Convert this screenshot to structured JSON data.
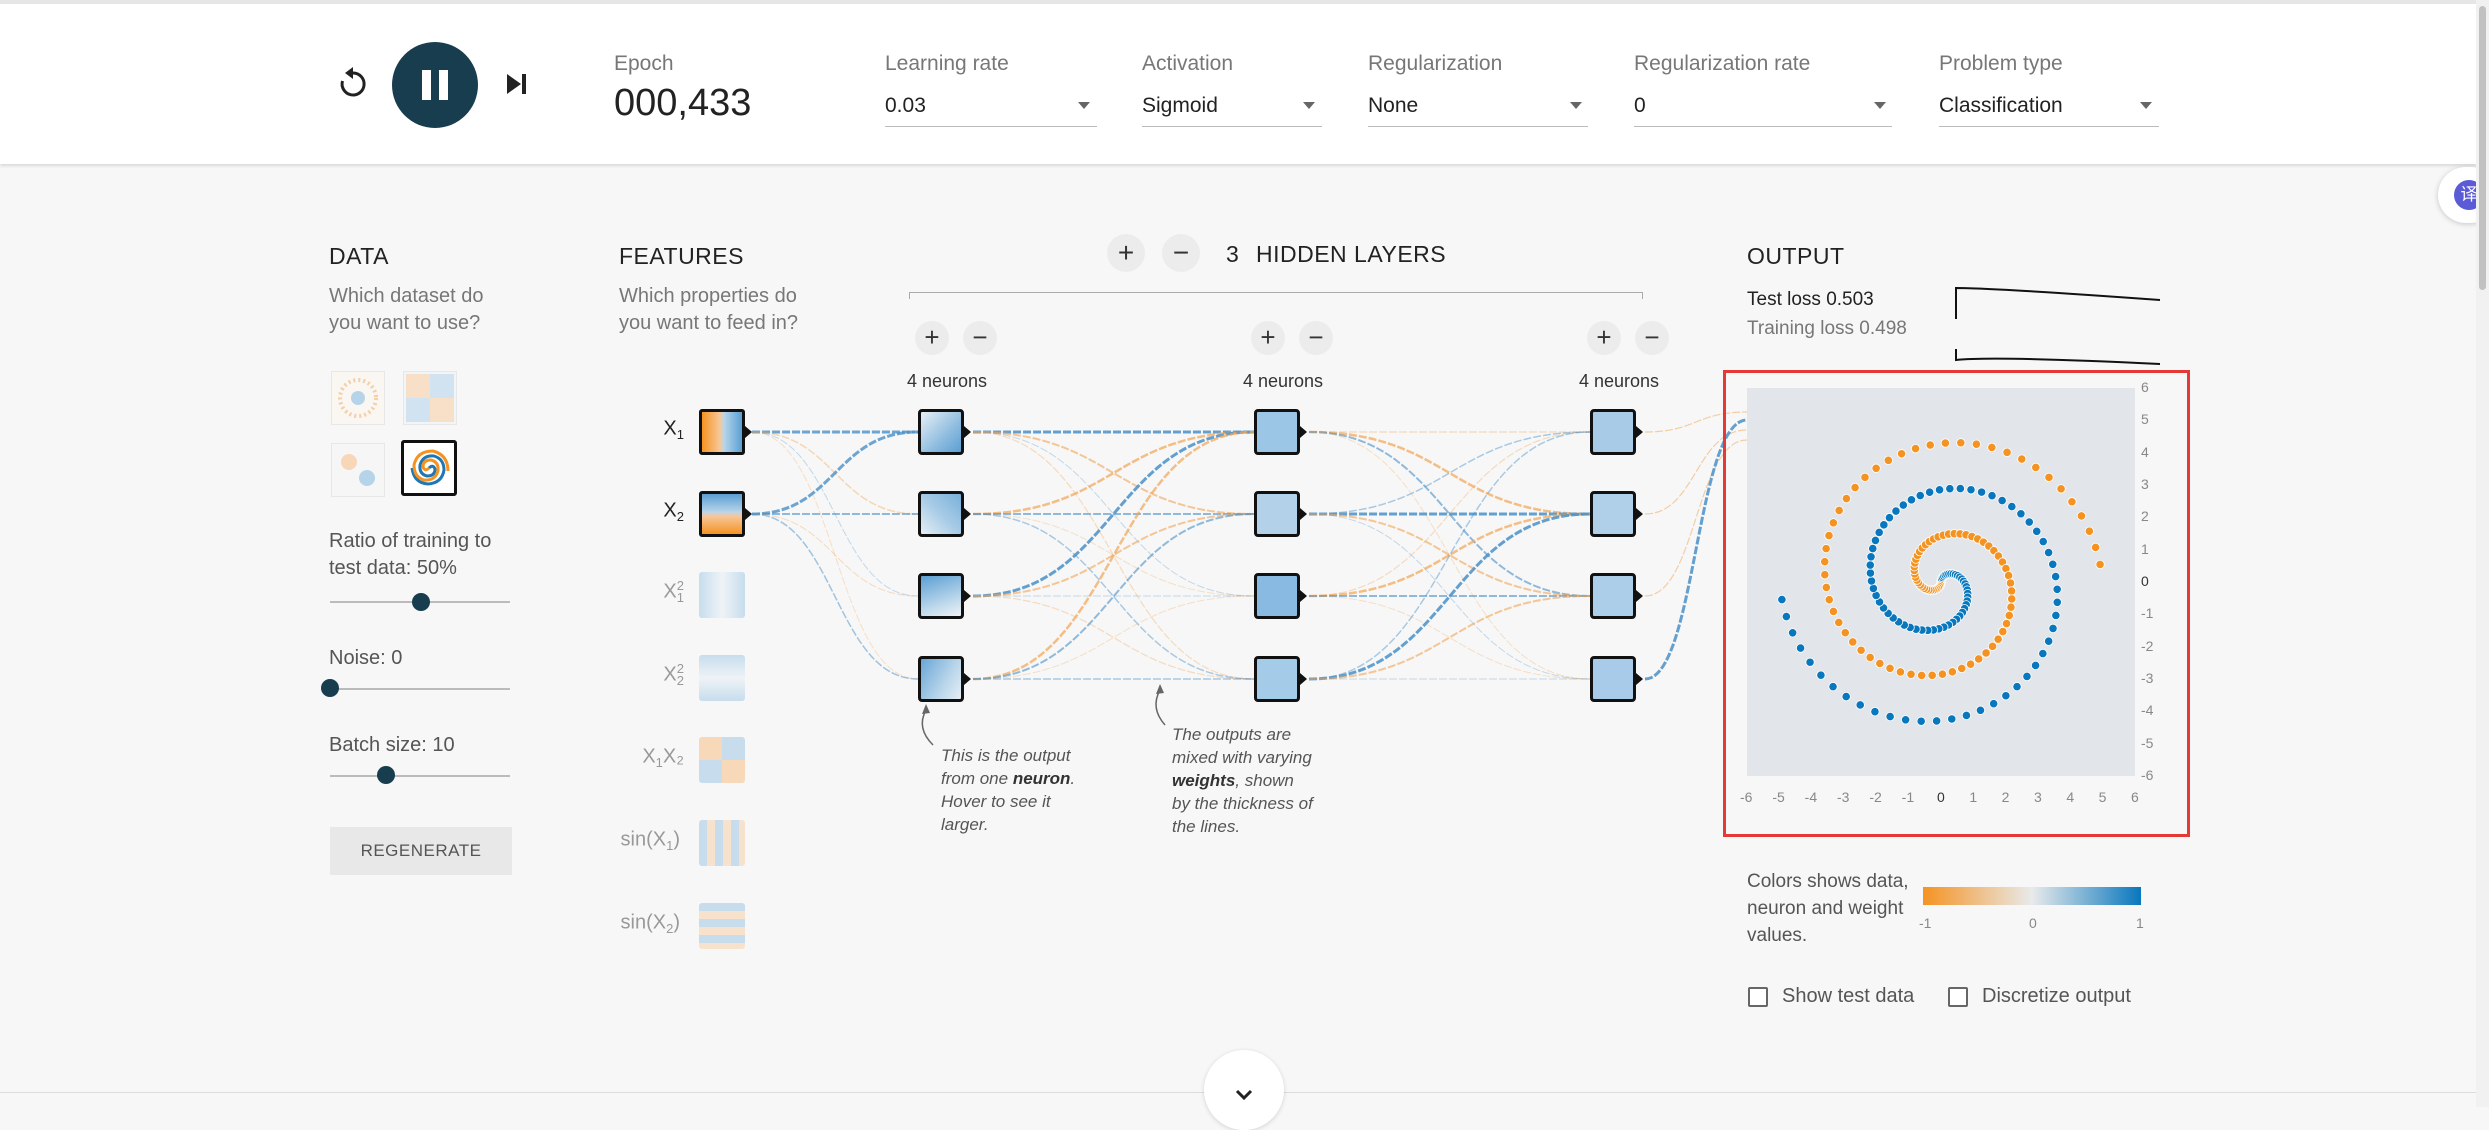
{
  "header": {
    "reset_icon": "reset-icon",
    "play_pause_icon": "pause-icon",
    "step_icon": "step-forward-icon",
    "epoch_label": "Epoch",
    "epoch_value": "000,433",
    "learning_rate_label": "Learning rate",
    "learning_rate_value": "0.03",
    "activation_label": "Activation",
    "activation_value": "Sigmoid",
    "regularization_label": "Regularization",
    "regularization_value": "None",
    "regularization_rate_label": "Regularization rate",
    "regularization_rate_value": "0",
    "problem_type_label": "Problem type",
    "problem_type_value": "Classification"
  },
  "data_panel": {
    "title": "DATA",
    "desc": "Which dataset do you want to use?",
    "ratio_label": "Ratio of training to test data:",
    "ratio_value": "50%",
    "ratio_fraction": 0.5,
    "noise_label": "Noise:",
    "noise_value": "0",
    "noise_fraction": 0,
    "batch_label": "Batch size:",
    "batch_value": "10",
    "batch_fraction": 0.3,
    "regenerate": "REGENERATE",
    "datasets": [
      "circle",
      "xor",
      "gauss",
      "spiral"
    ],
    "selected_dataset": "spiral"
  },
  "features_panel": {
    "title": "FEATURES",
    "desc": "Which properties do you want to feed in?",
    "features": [
      {
        "main": "X",
        "sub": "1",
        "sup": "",
        "suffix": "",
        "active": true
      },
      {
        "main": "X",
        "sub": "2",
        "sup": "",
        "suffix": "",
        "active": true
      },
      {
        "main": "X",
        "sub": "1",
        "sup": "2",
        "suffix": "",
        "active": false
      },
      {
        "main": "X",
        "sub": "2",
        "sup": "2",
        "suffix": "",
        "active": false
      },
      {
        "main": "X",
        "sub": "1",
        "sup": "",
        "suffix": "X₂",
        "active": false
      },
      {
        "main": "sin(X",
        "sub": "1",
        "sup": "",
        "suffix": ")",
        "active": false
      },
      {
        "main": "sin(X",
        "sub": "2",
        "sup": "",
        "suffix": ")",
        "active": false
      }
    ]
  },
  "network": {
    "layer_count": "3",
    "hidden_layers_label": "HIDDEN LAYERS",
    "layers": [
      {
        "neurons_label": "4 neurons"
      },
      {
        "neurons_label": "4 neurons"
      },
      {
        "neurons_label": "4 neurons"
      }
    ],
    "note1": [
      "This is the output",
      "from one neuron.",
      "Hover to see it",
      "larger."
    ],
    "note1_bold": "neuron",
    "note2": [
      "The outputs are",
      "mixed with varying",
      "weights, shown",
      "by the thickness of",
      "the lines."
    ],
    "note2_bold": "weights"
  },
  "output_panel": {
    "title": "OUTPUT",
    "test_loss_label": "Test loss",
    "test_loss_value": "0.503",
    "training_loss_label": "Training loss",
    "training_loss_value": "0.498",
    "colors_desc": "Colors shows data, neuron and weight values.",
    "scale_labels": [
      "-1",
      "0",
      "1"
    ],
    "show_test_data": "Show test data",
    "discretize_output": "Discretize output",
    "x_ticks": [
      "-6",
      "-5",
      "-4",
      "-3",
      "-2",
      "-1",
      "0",
      "1",
      "2",
      "3",
      "4",
      "5",
      "6"
    ],
    "y_ticks": [
      "6",
      "5",
      "4",
      "3",
      "2",
      "1",
      "0",
      "-1",
      "-2",
      "-3",
      "-4",
      "-5",
      "-6"
    ],
    "colors": {
      "positive": "#0877bd",
      "negative": "#f59322",
      "highlight": "#e53935"
    }
  },
  "misc": {
    "scroll_down_icon": "chevron-down-icon",
    "translate_icon": "translate-icon",
    "translate_glyph": "译"
  }
}
